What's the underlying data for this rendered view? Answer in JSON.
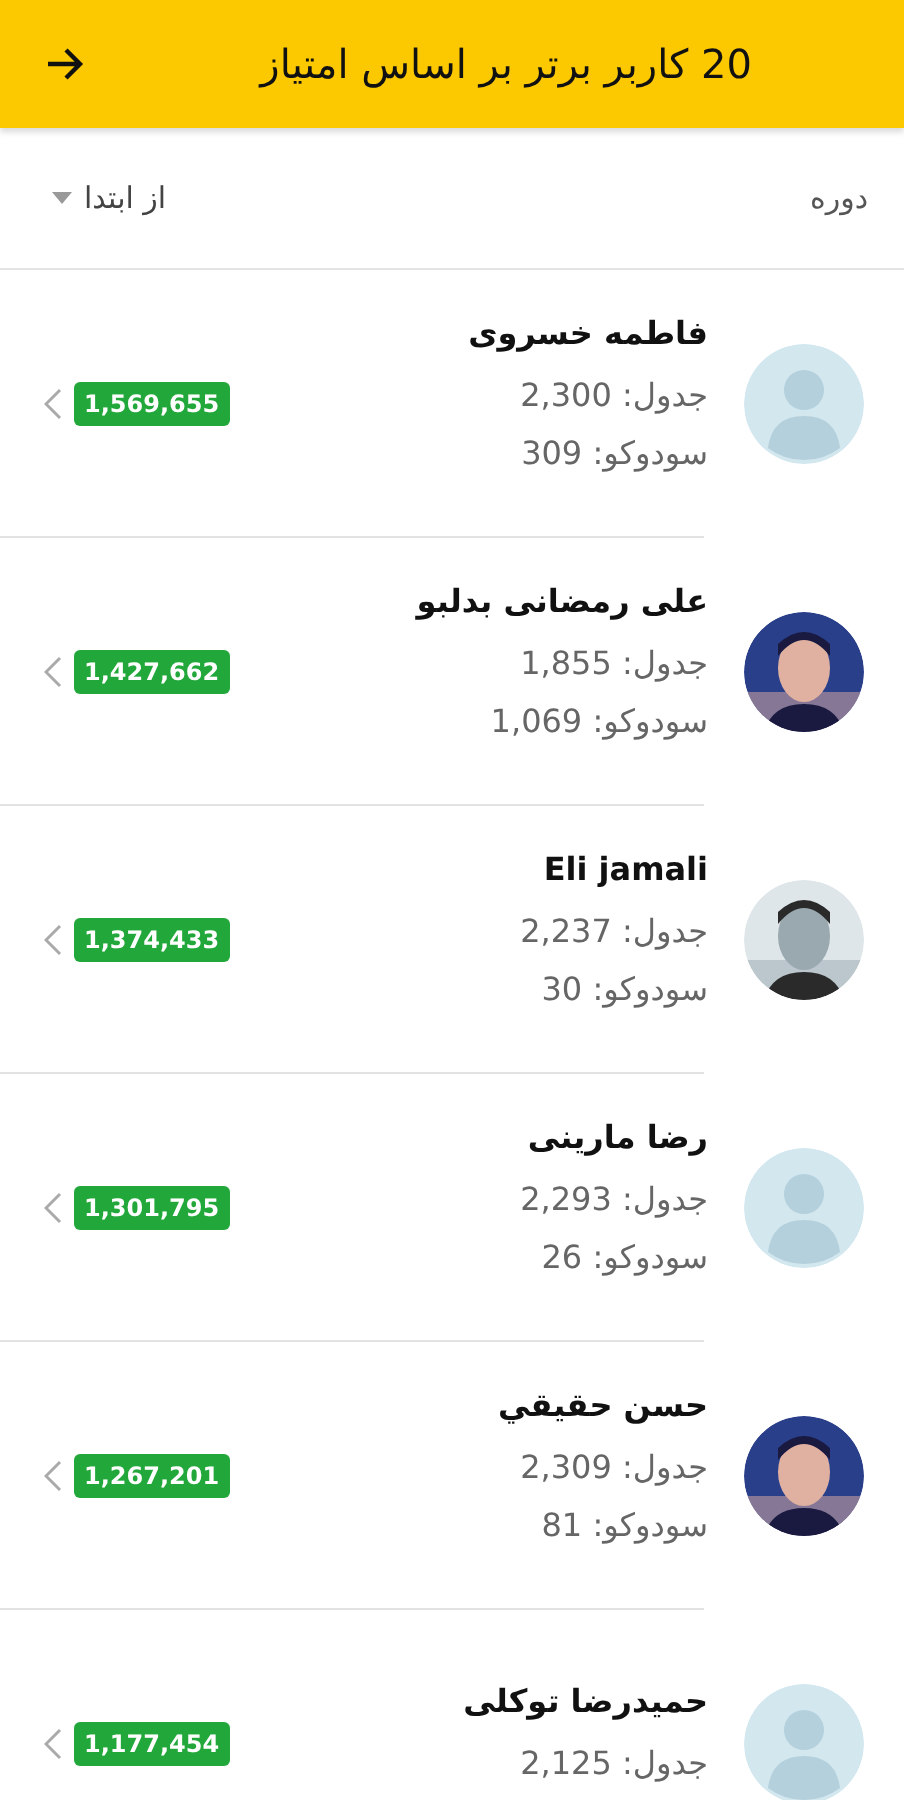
{
  "app_bar": {
    "title": "20 کاربر برتر بر اساس امتیاز"
  },
  "filter": {
    "label": "دوره",
    "value": "از ابتدا"
  },
  "users": [
    {
      "name": "فاطمه خسروی",
      "avatar": {
        "kind": "default"
      },
      "lines": [
        "جدول: 2,300",
        "سودوکو: 309"
      ],
      "score": "1,569,655"
    },
    {
      "name": "علی رمضانی بدلبو",
      "lines": [
        "جدول: 1,855",
        "سودوکو: 1,069"
      ],
      "score": "1,427,662"
    },
    {
      "name": "Eli jamali",
      "lines": [
        "جدول: 2,237",
        "سودوکو: 30"
      ],
      "score": "1,374,433"
    },
    {
      "name": "رضا مارینی",
      "avatar": {
        "kind": "default"
      },
      "lines": [
        "جدول: 2,293",
        "سودوکو: 26"
      ],
      "score": "1,301,795"
    },
    {
      "name": "حسن حقيقي",
      "lines": [
        "جدول: 2,309",
        "سودوکو: 81"
      ],
      "score": "1,267,201"
    },
    {
      "name": "حمیدرضا توکلی",
      "avatar": {
        "kind": "default"
      },
      "lines": [
        "جدول: 2,125"
      ],
      "score": "1,177,454"
    }
  ]
}
